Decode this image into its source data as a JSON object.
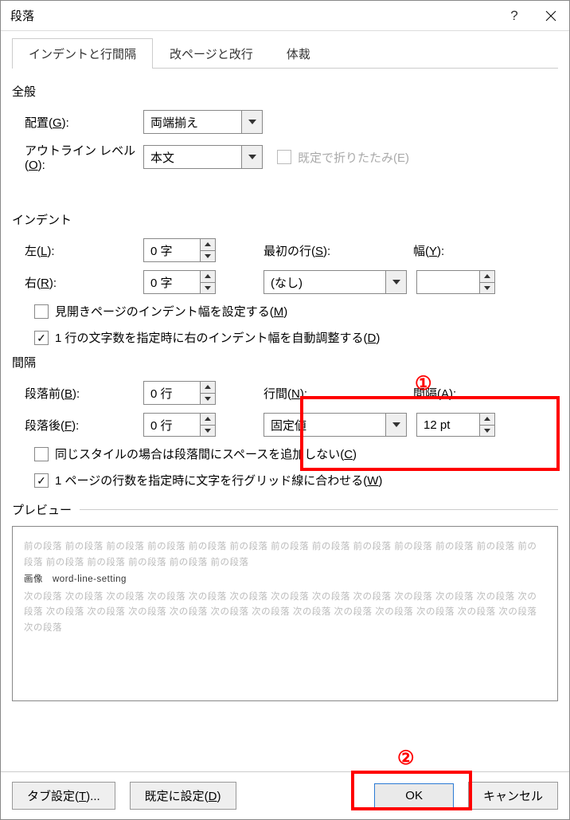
{
  "window": {
    "title": "段落"
  },
  "tabs": {
    "t1": "インデントと行間隔",
    "t2": "改ページと改行",
    "t3": "体裁"
  },
  "general": {
    "legend": "全般",
    "align_label_pre": "配置(",
    "align_key": "G",
    "align_label_post": "):",
    "align_value": "両端揃え",
    "outline_label_pre": "アウトライン レベル(",
    "outline_key": "O",
    "outline_label_post": "):",
    "outline_value": "本文",
    "collapse_label": "既定で折りたたみ(E)"
  },
  "indent": {
    "legend": "インデント",
    "left_label_pre": "左(",
    "left_key": "L",
    "left_label_post": "):",
    "left_value": "0 字",
    "right_label_pre": "右(",
    "right_key": "R",
    "right_label_post": "):",
    "right_value": "0 字",
    "first_label_pre": "最初の行(",
    "first_key": "S",
    "first_label_post": "):",
    "first_value": "(なし)",
    "width_label_pre": "幅(",
    "width_key": "Y",
    "width_label_post": "):",
    "width_value": "",
    "mirror_pre": "見開きページのインデント幅を設定する(",
    "mirror_key": "M",
    "mirror_post": ")",
    "auto_pre": "1 行の文字数を指定時に右のインデント幅を自動調整する(",
    "auto_key": "D",
    "auto_post": ")"
  },
  "spacing": {
    "legend": "間隔",
    "before_label_pre": "段落前(",
    "before_key": "B",
    "before_label_post": "):",
    "before_value": "0 行",
    "after_label_pre": "段落後(",
    "after_key": "F",
    "after_label_post": "):",
    "after_value": "0 行",
    "line_label_pre": "行間(",
    "line_key": "N",
    "line_label_post": "):",
    "line_value": "固定値",
    "at_label_pre": "間隔(",
    "at_key": "A",
    "at_label_post": "):",
    "at_value": "12 pt",
    "nospace_pre": "同じスタイルの場合は段落間にスペースを追加しない(",
    "nospace_key": "C",
    "nospace_post": ")",
    "snap_pre": "1 ページの行数を指定時に文字を行グリッド線に合わせる(",
    "snap_key": "W",
    "snap_post": ")"
  },
  "preview": {
    "legend": "プレビュー",
    "prev_text": "前の段落 前の段落 前の段落 前の段落 前の段落 前の段落 前の段落 前の段落 前の段落 前の段落 前の段落 前の段落 前の段落 前の段落 前の段落 前の段落 前の段落 前の段落",
    "sample_text": "画像　word-line-setting",
    "next_text": "次の段落 次の段落 次の段落 次の段落 次の段落 次の段落 次の段落 次の段落 次の段落 次の段落 次の段落 次の段落 次の段落 次の段落 次の段落 次の段落 次の段落 次の段落 次の段落 次の段落 次の段落 次の段落 次の段落 次の段落 次の段落 次の段落"
  },
  "footer": {
    "tabs_btn_pre": "タブ設定(",
    "tabs_key": "T",
    "tabs_btn_post": ")...",
    "default_btn_pre": "既定に設定(",
    "default_key": "D",
    "default_btn_post": ")",
    "ok": "OK",
    "cancel": "キャンセル"
  },
  "callouts": {
    "n1": "①",
    "n2": "②"
  }
}
